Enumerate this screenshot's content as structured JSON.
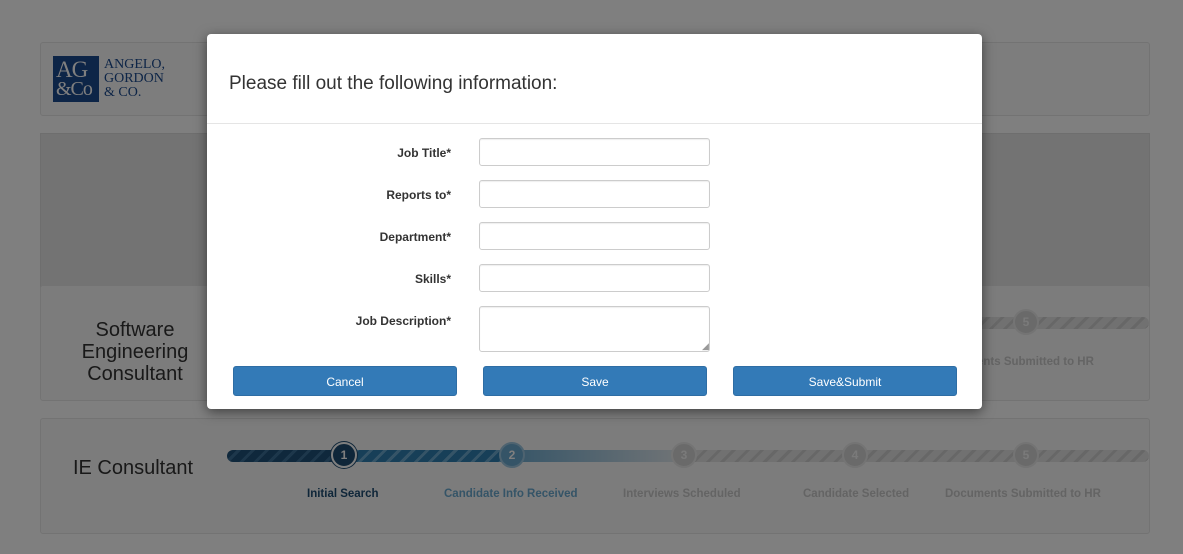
{
  "header": {
    "logo_mark_top": "AG",
    "logo_mark_bottom": "&Co",
    "logo_line1": "ANGELO,",
    "logo_line2": "GORDON",
    "logo_line3": "& CO."
  },
  "cards": [
    {
      "title": "Software Engineering Consultant",
      "visible_step_number": "5",
      "visible_step_label": "ents Submitted to HR"
    },
    {
      "title": "IE Consultant",
      "steps": [
        {
          "number": "1",
          "label": "Initial Search",
          "state": "complete"
        },
        {
          "number": "2",
          "label": "Candidate Info Received",
          "state": "in-progress"
        },
        {
          "number": "3",
          "label": "Interviews Scheduled",
          "state": "pending"
        },
        {
          "number": "4",
          "label": "Candidate Selected",
          "state": "pending"
        },
        {
          "number": "5",
          "label": "Documents Submitted to HR",
          "state": "pending"
        }
      ]
    }
  ],
  "modal": {
    "title": "Please fill out the following information:",
    "fields": [
      {
        "label": "Job Title*",
        "value": ""
      },
      {
        "label": "Reports to*",
        "value": ""
      },
      {
        "label": "Department*",
        "value": ""
      },
      {
        "label": "Skills*",
        "value": ""
      },
      {
        "label": "Job Description*",
        "value": ""
      }
    ],
    "buttons": {
      "cancel": "Cancel",
      "save": "Save",
      "save_submit": "Save&Submit"
    }
  },
  "colors": {
    "primary_button": "#337ab7",
    "step_complete": "#1e4d73",
    "step_in_progress": "#6aa9cf",
    "step_pending": "#d5d5d5",
    "logo": "#1b4a8f"
  }
}
